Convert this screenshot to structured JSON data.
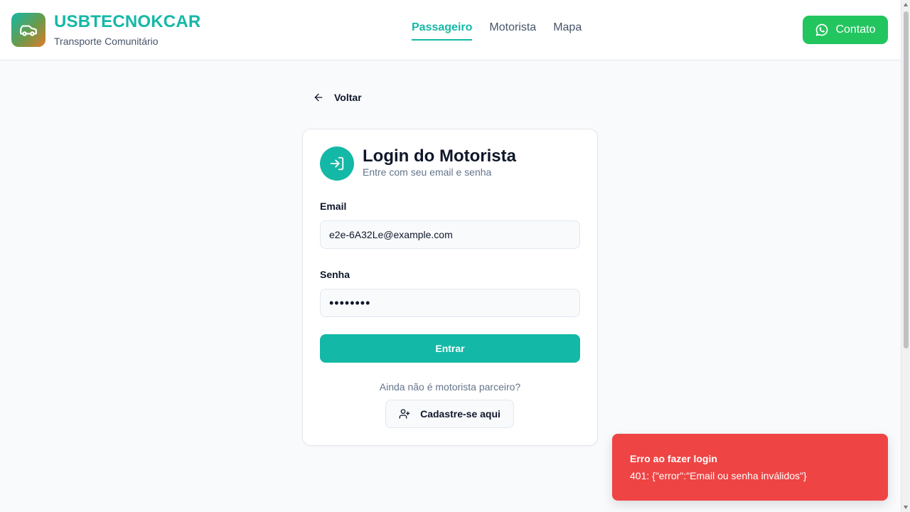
{
  "header": {
    "brand_name": "USBTECNOKCAR",
    "brand_sub": "Transporte Comunitário",
    "logo_icon": "car-icon",
    "nav": [
      {
        "label": "Passageiro",
        "active": true
      },
      {
        "label": "Motorista",
        "active": false
      },
      {
        "label": "Mapa",
        "active": false
      }
    ],
    "contact_label": "Contato",
    "contact_icon": "whatsapp-icon"
  },
  "back": {
    "label": "Voltar",
    "icon": "arrow-left-icon"
  },
  "card": {
    "icon": "login-icon",
    "title": "Login do Motorista",
    "subtitle": "Entre com seu email e senha",
    "email_label": "Email",
    "email_value": "e2e-6A32Le@example.com",
    "password_label": "Senha",
    "password_value": "••••••••",
    "submit_label": "Entrar",
    "register_prompt": "Ainda não é motorista parceiro?",
    "register_label": "Cadastre-se aqui",
    "register_icon": "user-plus-icon"
  },
  "toast": {
    "title": "Erro ao fazer login",
    "message": "401: {\"error\":\"Email ou senha inválidos\"}"
  },
  "colors": {
    "accent": "#14b8a6",
    "whatsapp": "#22c55e",
    "error": "#ef4444"
  }
}
